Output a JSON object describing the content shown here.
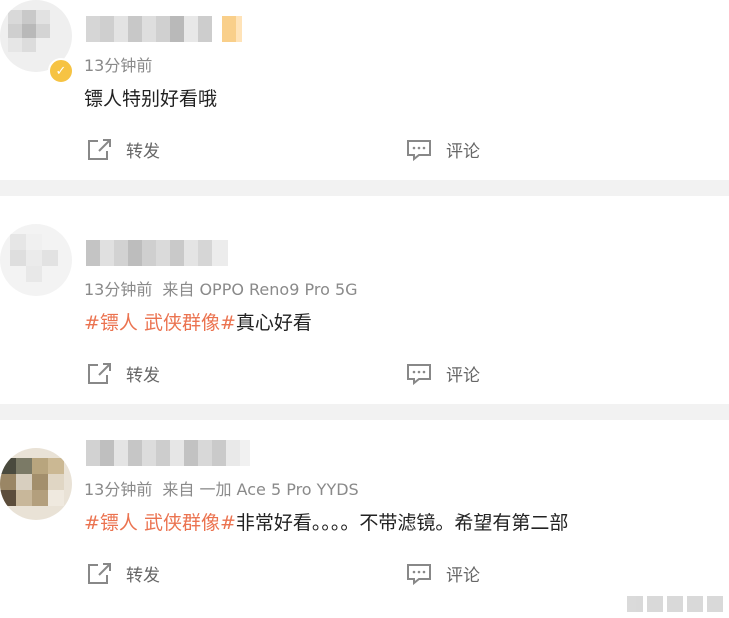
{
  "comments": [
    {
      "time": "13分钟前",
      "source": "",
      "tag": "",
      "text": "镖人特别好看哦",
      "repost_label": "转发",
      "comment_label": "评论"
    },
    {
      "time": "13分钟前",
      "source": "来自 OPPO Reno9 Pro 5G",
      "tag": "#镖人 武侠群像#",
      "text": "真心好看",
      "repost_label": "转发",
      "comment_label": "评论"
    },
    {
      "time": "13分钟前",
      "source": "来自 一加 Ace 5 Pro YYDS",
      "tag": "#镖人 武侠群像#",
      "text": "非常好看。。。。不带滤镜。希望有第二部",
      "repost_label": "转发",
      "comment_label": "评论"
    }
  ],
  "colors": {
    "tag": "#eb7350",
    "meta": "#8a8a8a",
    "separator": "#f2f2f2",
    "badge": "#f6c343"
  }
}
